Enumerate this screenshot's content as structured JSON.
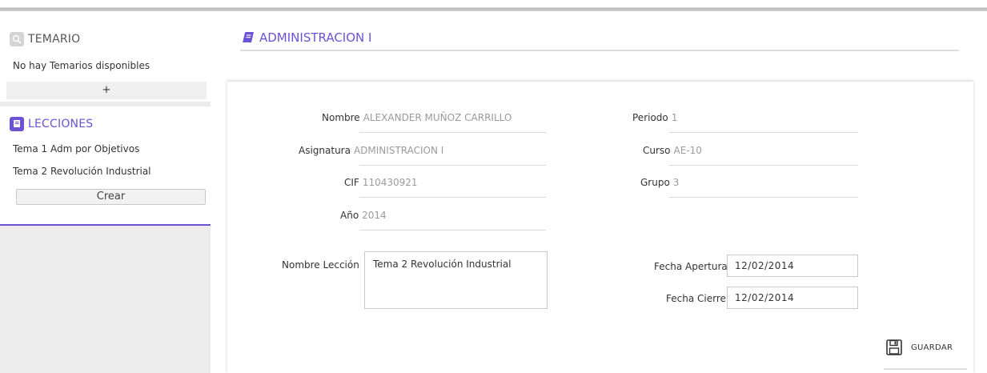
{
  "sidebar": {
    "temario": {
      "title": "TEMARIO",
      "empty_text": "No hay Temarios disponibles",
      "add_label": "+"
    },
    "lecciones": {
      "title": "LECCIONES",
      "items": [
        {
          "label": "Tema 1 Adm por Objetivos"
        },
        {
          "label": "Tema 2 Revolución Industrial"
        }
      ],
      "create_label": "Crear"
    }
  },
  "main": {
    "title": "ADMINISTRACION I",
    "info": {
      "nombre": {
        "label": "Nombre",
        "value": "ALEXANDER MUÑOZ CARRILLO"
      },
      "asignatura": {
        "label": "Asignatura",
        "value": "ADMINISTRACION I"
      },
      "cif": {
        "label": "CIF",
        "value": "110430921"
      },
      "anio": {
        "label": "Año",
        "value": "2014"
      },
      "periodo": {
        "label": "Periodo",
        "value": "1"
      },
      "curso": {
        "label": "Curso",
        "value": "AE-10"
      },
      "grupo": {
        "label": "Grupo",
        "value": "3"
      }
    },
    "form": {
      "nombre_leccion": {
        "label": "Nombre Lección",
        "value": "Tema 2 Revolución Industrial"
      },
      "fecha_apertura": {
        "label": "Fecha Apertura",
        "value": "12/02/2014"
      },
      "fecha_cierre": {
        "label": "Fecha Cierre",
        "value": "12/02/2014"
      }
    },
    "save_label": "GUARDAR"
  },
  "colors": {
    "accent": "#6b52d6",
    "muted_value": "#9a9a9a",
    "sidebar_bg": "#ececec"
  },
  "icons": [
    "search-icon",
    "book-icon",
    "save-icon"
  ]
}
